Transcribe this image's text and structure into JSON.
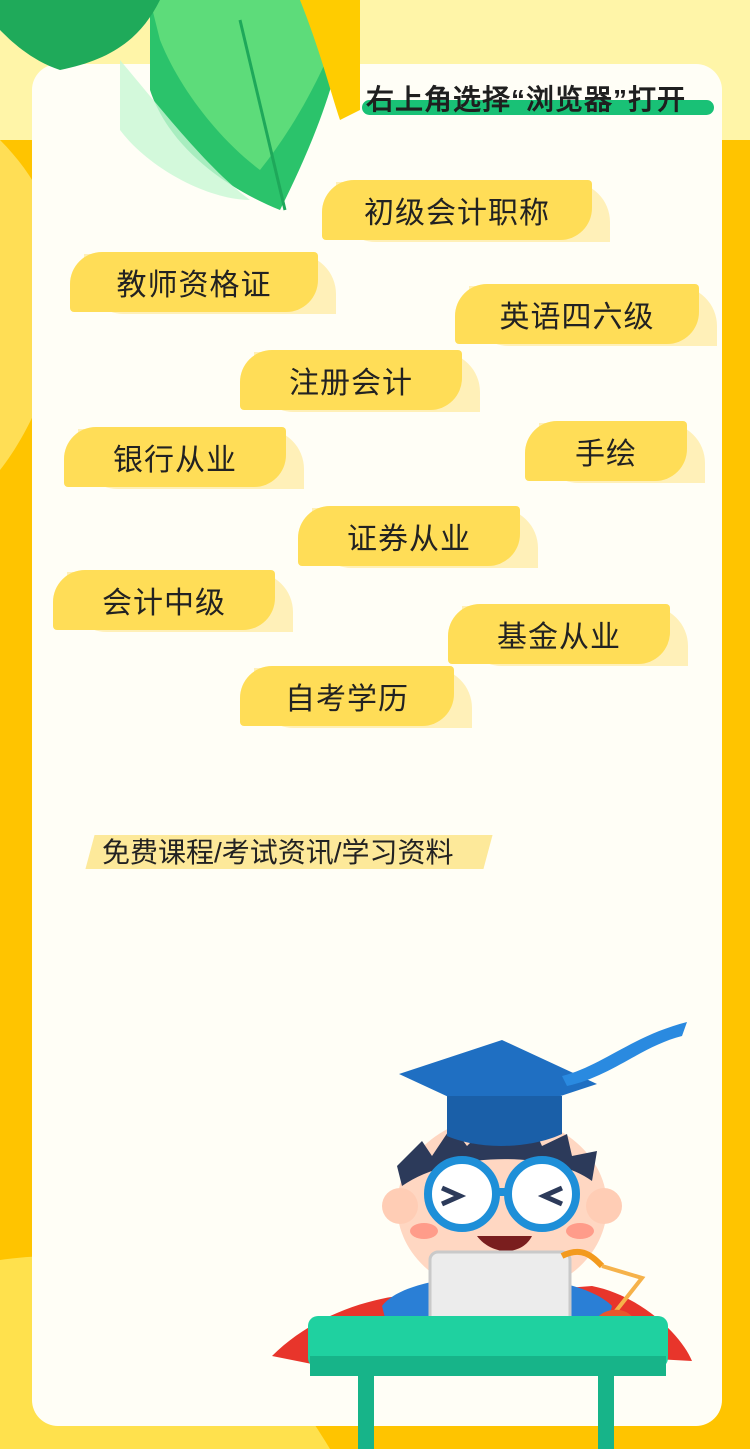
{
  "header": {
    "hint": "右上角选择“浏览器”打开"
  },
  "tags": [
    {
      "label": "初级会计职称"
    },
    {
      "label": "教师资格证"
    },
    {
      "label": "英语四六级"
    },
    {
      "label": "注册会计"
    },
    {
      "label": "银行从业"
    },
    {
      "label": "手绘"
    },
    {
      "label": "证券从业"
    },
    {
      "label": "会计中级"
    },
    {
      "label": "基金从业"
    },
    {
      "label": "自考学历"
    }
  ],
  "ribbon": {
    "text": "免费课程/考试资讯/学习资料"
  },
  "colors": {
    "background": "#ffc400",
    "pill": "#ffdd57",
    "accent_bar": "#19c176"
  }
}
